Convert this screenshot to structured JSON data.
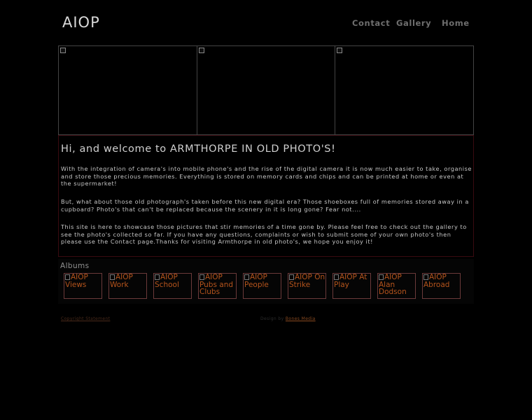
{
  "header": {
    "logo": "AIOP",
    "nav": [
      "Contact",
      "Gallery",
      "Home"
    ]
  },
  "hero": {
    "images": [
      "hero-image-1",
      "hero-image-2",
      "hero-image-3"
    ]
  },
  "welcome": {
    "title": "Hi, and welcome to ARMTHORPE IN OLD PHOTO'S!",
    "paragraphs": [
      "With the integration of camera's into mobile phone's and the rise of the digital camera it is now much easier to take, organise and store those precious memories. Everything is stored on memory cards and chips and can be printed at home or even at the supermarket!",
      "But, what about those old photograph's taken before this new digital era? Those shoeboxes full of memories stored away in a cupboard? Photo's that can't be replaced because the scenery in it is long gone? Fear not....",
      "This site is here to showcase those pictures that stir memories of a time gone by. Please feel free to check out the gallery to see the photo's collected so far. If you have any questions, complaints or wish to submit some of your own photo's then please use the Contact page.Thanks for visiting Armthorpe in old photo's, we hope you enjoy it!"
    ]
  },
  "albums": {
    "title": "Albums",
    "items": [
      "AIOP Views",
      "AIOP Work",
      "AIOP School",
      "AIOP Pubs and Clubs",
      "AIOP People",
      "AIOP On Strike",
      "AIOP At Play",
      "AIOP Alan Dodson",
      "AIOP Abroad"
    ]
  },
  "footer": {
    "copyright": "Copyright Statement",
    "design_prefix": "Design by",
    "design_brand": "Bones Media"
  },
  "colors": {
    "background": "#000000",
    "accent": "#b5541c",
    "border_red": "#3a0a10"
  }
}
